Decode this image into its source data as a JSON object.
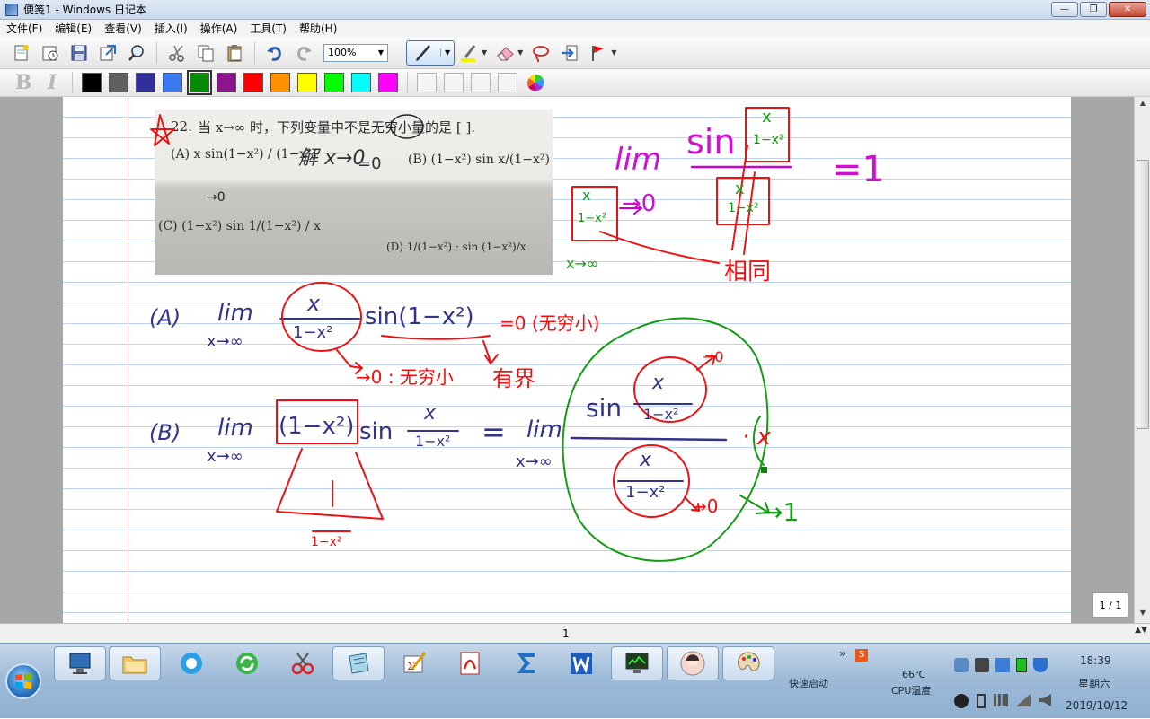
{
  "window": {
    "title": "便笺1 - Windows 日记本",
    "controls": {
      "minimize": "—",
      "maximize": "❐",
      "close": "✕"
    }
  },
  "menu": [
    "文件(F)",
    "编辑(E)",
    "查看(V)",
    "插入(I)",
    "操作(A)",
    "工具(T)",
    "帮助(H)"
  ],
  "toolbar": {
    "zoom": "100%"
  },
  "format": {
    "bold": "B",
    "italic": "I"
  },
  "colors": {
    "palette": [
      "#000000",
      "#606060",
      "#31309a",
      "#3b79ee",
      "#058a06",
      "#8a168b",
      "#ff0000",
      "#ff9000",
      "#ffff00",
      "#00ff00",
      "#00ffff",
      "#ff00ff"
    ],
    "selected_index": 4
  },
  "note": {
    "problem_number": "22.",
    "problem_text": "当 x→∞ 时，下列变量中不是无穷小量的是 [    ].",
    "option_a": "(A)  x sin(1−x²) / (1−x²)",
    "option_b": "(B) (1−x²) sin x/(1−x²)",
    "option_c": "(C) (1−x²) sin 1/(1−x²) / x",
    "option_d": "(D) 1/(1−x²) · sin (1−x²)/x",
    "hw_jie": "解 x→0",
    "hw_eq0": "=0",
    "hw_to0_c": "→0",
    "hw_lim": "lim",
    "hw_sin": "sin",
    "hw_eq1": "=1",
    "hw_to0": "→0",
    "hw_x_inf": "x→∞",
    "hw_xtoinf": "x→∞",
    "hw_same": "相同",
    "hw_a_label": "(A)",
    "hw_a_sin": "sin(1−x²)",
    "hw_a_result": "=0 (无穷小)",
    "hw_a_infinitesimal": "→0 : 无穷小",
    "hw_a_bounded": "有界",
    "hw_b_label": "(B)",
    "hw_b_factor": "(1−x²)",
    "hw_b_sin": "sin",
    "hw_b_eq": "=",
    "hw_b_dot_x": "· x",
    "hw_b_to0a": "→0",
    "hw_b_to0b": "→0",
    "hw_b_result": "→1",
    "hw_b_denom": "1−x²",
    "hw_frac_x": "x",
    "hw_frac_den": "1−x²"
  },
  "status": {
    "page": "1",
    "page_indicator": "1 / 1"
  },
  "tray": {
    "quick_launch": "快速启动",
    "cpu_temp": "66℃",
    "cpu_label": "CPU温度",
    "time": "18:39",
    "weekday": "星期六",
    "date": "2019/10/12"
  }
}
